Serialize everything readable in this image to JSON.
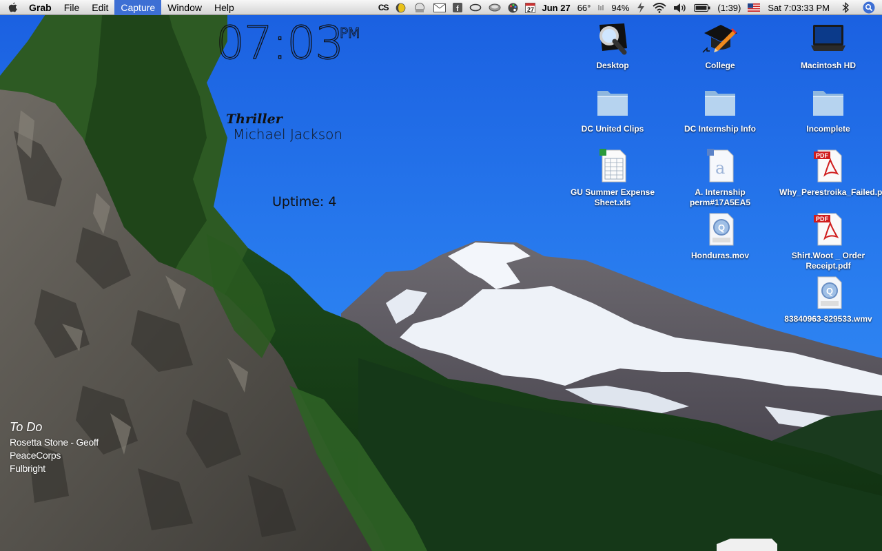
{
  "menubar": {
    "app_name": "Grab",
    "menus": [
      "File",
      "Edit",
      "Capture",
      "Window",
      "Help"
    ],
    "status": {
      "date": "Jun 27",
      "calendar_day": "27",
      "temperature": "66°",
      "battery_percent": "94%",
      "battery_time": "(1:39)",
      "clock": "Sat 7:03:33 PM"
    }
  },
  "clock_widget": {
    "time": "07:03",
    "ampm": "PM"
  },
  "now_playing": {
    "title": "Thriller",
    "artist": "Michael Jackson"
  },
  "uptime": "Uptime: 4",
  "todo": {
    "title": "To Do",
    "items": [
      "Rosetta Stone - Geoff",
      "PeaceCorps",
      "Fulbright"
    ]
  },
  "desktop_icons": [
    {
      "label": "Desktop",
      "icon": "magnifier-icon"
    },
    {
      "label": "College",
      "icon": "grad-cap-alias-icon"
    },
    {
      "label": "Macintosh HD",
      "icon": "hard-drive-icon"
    },
    {
      "label": "DC United Clips",
      "icon": "folder-icon"
    },
    {
      "label": "DC Internship Info",
      "icon": "folder-icon"
    },
    {
      "label": "Incomplete",
      "icon": "folder-icon"
    },
    {
      "label": "GU Summer Expense Sheet.xls",
      "icon": "spreadsheet-icon"
    },
    {
      "label": "A.  Internship perm#17A5EA5",
      "icon": "document-icon"
    },
    {
      "label": "Why_Perestroika_Failed.pdf",
      "icon": "pdf-icon"
    },
    {
      "label": "Honduras.mov",
      "icon": "movie-icon"
    },
    {
      "label": "Shirt.Woot _ Order Receipt.pdf",
      "icon": "pdf-icon"
    },
    {
      "label": "83840963-829533.wmv",
      "icon": "wmv-icon"
    }
  ],
  "colors": {
    "menu_active": "#3d6fd4",
    "sky": "#1f6ee6"
  }
}
